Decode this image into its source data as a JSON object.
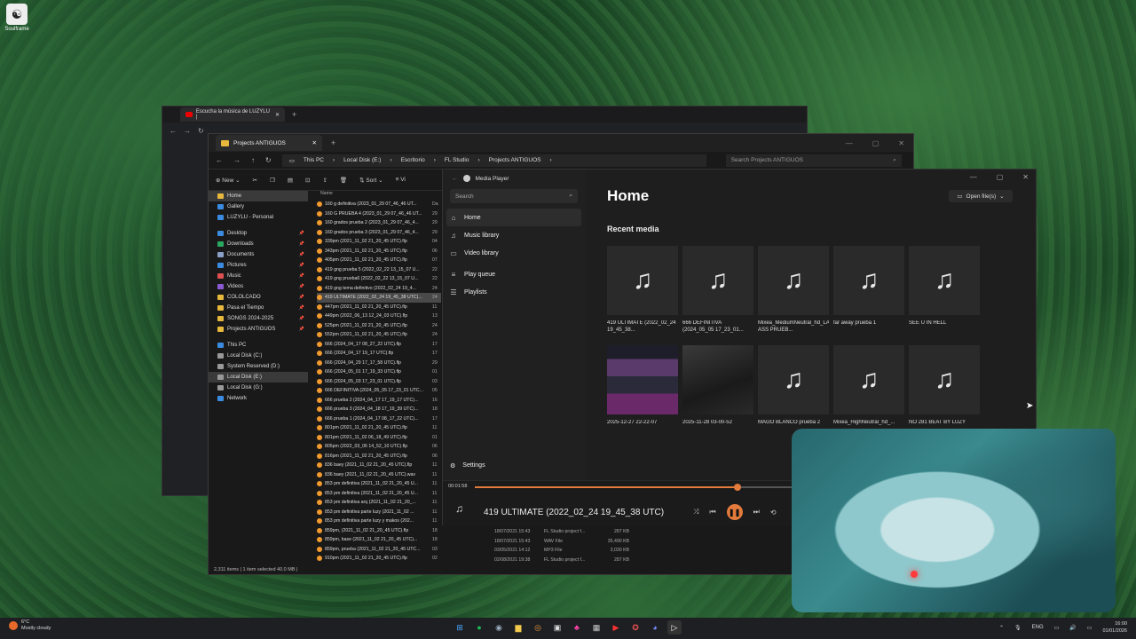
{
  "desktop": {
    "icon_label": "Soulframe"
  },
  "browser": {
    "tab_title": "Escucha la música de LUZYLU |"
  },
  "explorer": {
    "tab_title": "Projects ANTIGUOS",
    "breadcrumb": [
      "This PC",
      "Local Disk (E:)",
      "Escritorio",
      "FL Studio",
      "Projects ANTIGUOS"
    ],
    "search_placeholder": "Search Projects ANTIGUOS",
    "cmd": {
      "new": "New",
      "sort": "Sort",
      "view": "Vi"
    },
    "nav_top": [
      {
        "label": "Home",
        "icon": "home-icon",
        "color": "#e8b93c"
      },
      {
        "label": "Gallery",
        "icon": "gallery-icon",
        "color": "#3b8be0"
      },
      {
        "label": "LUZYLU - Personal",
        "icon": "onedrive-icon",
        "color": "#3b8be0"
      }
    ],
    "nav_quick": [
      {
        "label": "Desktop",
        "color": "#3b8be0"
      },
      {
        "label": "Downloads",
        "color": "#2aa860"
      },
      {
        "label": "Documents",
        "color": "#8aa0c8"
      },
      {
        "label": "Pictures",
        "color": "#3b8be0"
      },
      {
        "label": "Music",
        "color": "#e05050"
      },
      {
        "label": "Videos",
        "color": "#8a5ad0"
      },
      {
        "label": "COLOLCADO",
        "color": "#e8b93c"
      },
      {
        "label": "Pasa el Tiempo",
        "color": "#e8b93c"
      },
      {
        "label": "SONGS 2024-2025",
        "color": "#e8b93c"
      },
      {
        "label": "Projects ANTIGUOS",
        "color": "#e8b93c"
      }
    ],
    "nav_pc": [
      {
        "label": "This PC",
        "color": "#3b8be0"
      },
      {
        "label": "Local Disk (C:)",
        "color": "#999"
      },
      {
        "label": "System Reserved (D:)",
        "color": "#999"
      },
      {
        "label": "Local Disk (E:)",
        "color": "#999"
      },
      {
        "label": "Local Disk (G:)",
        "color": "#999"
      },
      {
        "label": "Network",
        "color": "#3b8be0"
      }
    ],
    "col_name": "Name",
    "files": [
      {
        "name": "160 g definitiva (2023_01_29 07_46_46 UT...",
        "date": "Da"
      },
      {
        "name": "160 G PRUEBA 4 (2023_01_29 07_46_46 UT...",
        "date": "29"
      },
      {
        "name": "160 grados prueba 2 (2023_01_29 07_46_4...",
        "date": "29"
      },
      {
        "name": "160 grados prueba 3 (2023_01_29 07_46_4...",
        "date": "29"
      },
      {
        "name": "339pm (2021_11_02 21_20_45 UTC).flp",
        "date": "04"
      },
      {
        "name": "343pm (2021_11_02 21_20_45 UTC).flp",
        "date": "06"
      },
      {
        "name": "405pm (2021_11_02 21_20_45 UTC).flp",
        "date": "07"
      },
      {
        "name": "419 gng prueba 5 (2022_02_22 13_15_07 U...",
        "date": "22"
      },
      {
        "name": "419 gng prueba6 (2022_02_22 13_15_07 U...",
        "date": "22"
      },
      {
        "name": "419 gng tema definitivo (2022_02_24 19_4...",
        "date": "24"
      },
      {
        "name": "419 ULTIMATE (2022_02_24 19_45_38 UTC)...",
        "date": "24",
        "selected": true
      },
      {
        "name": "447pm (2021_11_02 21_20_45 UTC).flp",
        "date": "11"
      },
      {
        "name": "449pm (2022_06_13 12_24_03 UTC).flp",
        "date": "13"
      },
      {
        "name": "525pm (2021_11_02 21_20_45 UTC).flp",
        "date": "24"
      },
      {
        "name": "552pm (2021_11_02 21_20_45 UTC).flp",
        "date": "24"
      },
      {
        "name": "666 (2024_04_17 08_27_22 UTC).flp",
        "date": "17"
      },
      {
        "name": "666 (2024_04_17 19_17 UTC).flp",
        "date": "17"
      },
      {
        "name": "666 (2024_04_29 17_17_58 UTC).flp",
        "date": "29"
      },
      {
        "name": "666 (2024_05_01 17_19_33 UTC).flp",
        "date": "01"
      },
      {
        "name": "666 (2024_05_03 17_23_01 UTC).flp",
        "date": "03"
      },
      {
        "name": "666 DEFINITIVA (2024_05_05 17_23_01 UTC...",
        "date": "05"
      },
      {
        "name": "666 prueba 2 (2024_04_17 17_19_17 UTC)...",
        "date": "16"
      },
      {
        "name": "666 prueba 3 (2024_04_18 17_19_39 UTC)...",
        "date": "18"
      },
      {
        "name": "666 prueba 1 (2024_04_17 08_17_22 UTC)...",
        "date": "17"
      },
      {
        "name": "801pm (2021_11_02 21_20_45 UTC).flp",
        "date": "11"
      },
      {
        "name": "801pm (2021_11_02 06_18_49 UTC).flp",
        "date": "01"
      },
      {
        "name": "805pm (2022_03_06 14_52_10 UTC).flp",
        "date": "06"
      },
      {
        "name": "816pm (2021_11_02 21_20_45 UTC).flp",
        "date": "06"
      },
      {
        "name": "836 baey (2021_11_02 21_20_45 UTC).flp",
        "date": "11"
      },
      {
        "name": "836 baey (2021_11_02 21_20_45 UTC).wav",
        "date": "11"
      },
      {
        "name": "853 pm definitiva (2021_11_02 21_20_45 U...",
        "date": "11"
      },
      {
        "name": "853 pm definitiva (2021_11_02 21_20_45 U...",
        "date": "11"
      },
      {
        "name": "853 pm definitiva arq (2021_11_02 21_20_...",
        "date": "11"
      },
      {
        "name": "853 pm definitiva parte luzy (2021_11_02 ...",
        "date": "11"
      },
      {
        "name": "853 pm definitiva parte luzy y makos (202...",
        "date": "11"
      },
      {
        "name": "859pm, (2021_11_02 21_20_45 UTC).flp",
        "date": "18"
      },
      {
        "name": "859pm, base (2021_11_02 21_20_45 UTC)...",
        "date": "18"
      },
      {
        "name": "859pm, prueba (2021_11_02 21_20_45 UTC...",
        "date": "03"
      },
      {
        "name": "910pm (2021_11_02 21_20_45 UTC).flp",
        "date": "02"
      }
    ],
    "details": [
      {
        "date": "18/07/2021 15:43",
        "type": "FL Studio project f...",
        "size": "287 KB"
      },
      {
        "date": "18/07/2021 15:43",
        "type": "WAV File",
        "size": "35,490 KB"
      },
      {
        "date": "03/05/2021 14:12",
        "type": "MP3 File",
        "size": "3,030 KB"
      },
      {
        "date": "02/08/2021 19:38",
        "type": "FL Studio project f...",
        "size": "287 KB"
      }
    ],
    "status": "2,311 items  |  1 item selected  40.0 MB  |"
  },
  "media_player": {
    "title": "Media Player",
    "search_placeholder": "Search",
    "nav": [
      {
        "label": "Home",
        "icon": "⌂",
        "name": "home"
      },
      {
        "label": "Music library",
        "icon": "♫",
        "name": "music-library"
      },
      {
        "label": "Video library",
        "icon": "▭",
        "name": "video-library"
      },
      {
        "label": "Play queue",
        "icon": "≡",
        "name": "play-queue"
      },
      {
        "label": "Playlists",
        "icon": "☰",
        "name": "playlists"
      }
    ],
    "settings_label": "Settings",
    "home_heading": "Home",
    "recent_heading": "Recent media",
    "open_files": "Open file(s)",
    "recent": [
      {
        "label": "419 ULTIMATE (2022_02_24 19_45_38...",
        "thumb": "note"
      },
      {
        "label": "666 DEFINITIVA (2024_05_05 17_23_01...",
        "thumb": "note"
      },
      {
        "label": "Mixea_MediumNeutral_hd_LAME ASS PRUEB...",
        "thumb": "note"
      },
      {
        "label": "far away prueba 1",
        "thumb": "note"
      },
      {
        "label": "SEE U IN HELL",
        "thumb": "note"
      },
      {
        "label": "2025-12-27 22-22-07",
        "thumb": "img1"
      },
      {
        "label": "2025-11-28 03-00-52",
        "thumb": "img2"
      },
      {
        "label": "MAGO BLANCO prueba 2",
        "thumb": "note"
      },
      {
        "label": "Mixea_HighNeutral_hd_...",
        "thumb": "note"
      },
      {
        "label": "NO 281 BEAT BY LUZY",
        "thumb": "note"
      }
    ],
    "elapsed": "00:01:58",
    "progress": 0.57,
    "now_playing": "419 ULTIMATE (2022_02_24 19_45_38 UTC)"
  },
  "taskbar": {
    "temp": "6°C",
    "weather": "Mostly cloudy",
    "lang": "ENG",
    "time": "16:00",
    "date": "01/01/2026"
  }
}
